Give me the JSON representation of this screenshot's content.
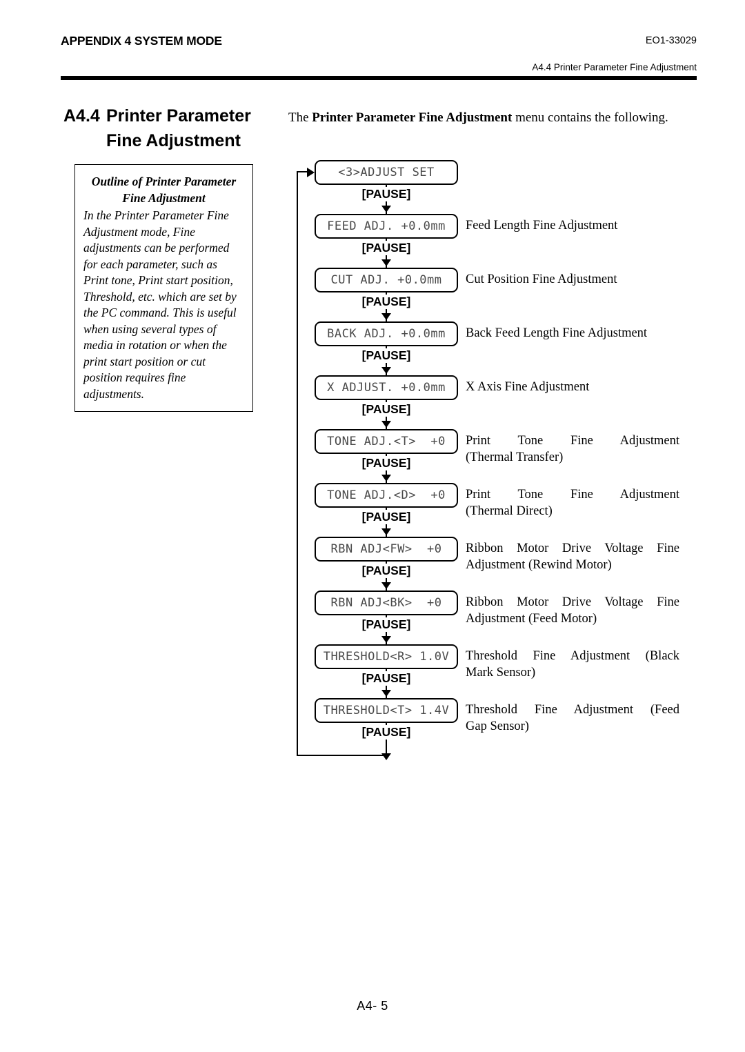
{
  "header": {
    "chapter": "APPENDIX 4 SYSTEM MODE",
    "doc_number": "EO1-33029",
    "subtitle": "A4.4 Printer Parameter Fine Adjustment"
  },
  "section": {
    "number": "A4.4",
    "title_line1": "Printer Parameter",
    "title_line2": "Fine Adjustment"
  },
  "outline": {
    "heading_line1": "Outline of Printer Parameter",
    "heading_line2": "Fine Adjustment",
    "body": "In the Printer Parameter Fine Adjustment mode, Fine adjustments can be performed for each parameter, such as Print tone, Print start position, Threshold, etc. which are set by the PC command. This is useful when using several types of media in rotation or when the print start position or cut position requires fine adjustments."
  },
  "intro": {
    "prefix": "The ",
    "bold": "Printer Parameter Fine Adjustment",
    "suffix": " menu contains the following."
  },
  "flow": {
    "key_label": "[PAUSE]",
    "steps": [
      {
        "lcd": "<3>ADJUST SET",
        "desc_line1": "",
        "desc_line2": ""
      },
      {
        "lcd": "FEED ADJ. +0.0mm",
        "desc_line1": "Feed Length Fine Adjustment",
        "desc_line2": ""
      },
      {
        "lcd": "CUT ADJ. +0.0mm",
        "desc_line1": "Cut Position Fine Adjustment",
        "desc_line2": ""
      },
      {
        "lcd": "BACK ADJ. +0.0mm",
        "desc_line1": "Back Feed Length Fine Adjustment",
        "desc_line2": ""
      },
      {
        "lcd": "X ADJUST. +0.0mm",
        "desc_line1": "X Axis Fine Adjustment",
        "desc_line2": ""
      },
      {
        "lcd": "TONE ADJ.<T>  +0",
        "desc_line1": "Print Tone Fine Adjustment",
        "desc_line2": "(Thermal Transfer)"
      },
      {
        "lcd": "TONE ADJ.<D>  +0",
        "desc_line1": "Print Tone Fine Adjustment",
        "desc_line2": "(Thermal Direct)"
      },
      {
        "lcd": "RBN ADJ<FW>  +0",
        "desc_line1": "Ribbon Motor Drive Voltage Fine",
        "desc_line2": "Adjustment (Rewind Motor)"
      },
      {
        "lcd": "RBN ADJ<BK>  +0",
        "desc_line1": "Ribbon Motor Drive Voltage Fine",
        "desc_line2": "Adjustment (Feed Motor)"
      },
      {
        "lcd": "THRESHOLD<R> 1.0V",
        "desc_line1": "Threshold Fine Adjustment (Black",
        "desc_line2": "Mark Sensor)"
      },
      {
        "lcd": "THRESHOLD<T> 1.4V",
        "desc_line1": "Threshold Fine Adjustment (Feed",
        "desc_line2": "Gap Sensor)"
      }
    ]
  },
  "footer": {
    "page": "A4- 5"
  }
}
